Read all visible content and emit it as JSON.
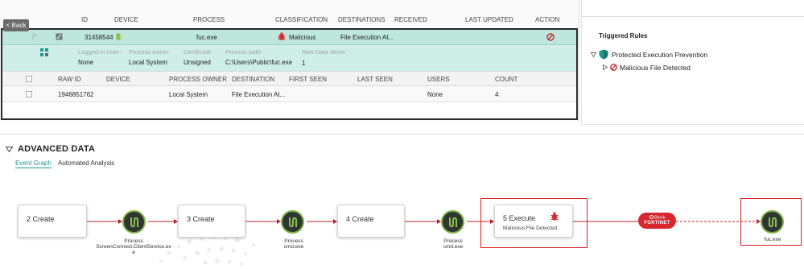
{
  "alerts_table": {
    "headers": {
      "id": "ID",
      "device": "DEVICE",
      "process": "PROCESS",
      "classification": "CLASSIFICATION",
      "destinations": "DESTINATIONS",
      "received": "RECEIVED",
      "last_updated": "LAST UPDATED",
      "action": "ACTION"
    },
    "back_label": "< Back",
    "selected_row": {
      "id": "31458544",
      "process": "fuc.exe",
      "classification": "Malicious",
      "destinations": "File Execution At..."
    },
    "details": {
      "logged_in_user_label": "Logged-in User:",
      "logged_in_user_value": "None",
      "process_owner_label": "Process owner:",
      "process_owner_value": "Local System",
      "certificate_label": "Certificate:",
      "certificate_value": "Unsigned",
      "process_path_label": "Process path:",
      "process_path_value": "C:\\Users\\Public\\fuc.exe",
      "raw_data_items_label": "Raw Data Items:",
      "raw_data_items_value": "1"
    },
    "raw_headers": {
      "raw_id": "RAW ID",
      "device": "DEVICE",
      "process_owner": "PROCESS OWNER",
      "destination": "DESTINATION",
      "first_seen": "FIRST SEEN",
      "last_seen": "LAST SEEN",
      "users": "USERS",
      "count": "COUNT"
    },
    "raw_row": {
      "raw_id": "1946851762",
      "process_owner": "Local System",
      "destination": "File Execution At...",
      "users": "None",
      "count": "4"
    }
  },
  "triggered_rules": {
    "title": "Triggered Rules",
    "policy": "Protected Execution Prevention",
    "rule": "Malicious File Detected"
  },
  "advanced_data": {
    "title": "ADVANCED DATA",
    "tabs": [
      "Event Graph",
      "Automated Analysis"
    ],
    "active_tab": "Event Graph",
    "graph": {
      "create_2": "2 Create",
      "process_1_line1": "Process",
      "process_1_line2": "ScreenConnect.ClientService.ex",
      "process_1_line3": "e",
      "create_3": "3 Create",
      "process_2_line1": "Process",
      "process_2_line2": "cmd.exe",
      "create_4": "4 Create",
      "process_3_line1": "Process",
      "process_3_line2": "cmd.exe",
      "execute_5": "5 Execute",
      "execute_5_sub": "Malicious File Detected",
      "block_label": "Block",
      "brand": "FORTINET",
      "target_label": "fuc.exe"
    }
  },
  "colors": {
    "selected_row": "#bde6dd",
    "detail_row": "#cfeee7",
    "accent_teal": "#1d9b8e",
    "malicious_red": "#d7262e",
    "highlight_frame": "#e02020",
    "process_node": "#2f3532",
    "process_ring": "#7cb342"
  }
}
